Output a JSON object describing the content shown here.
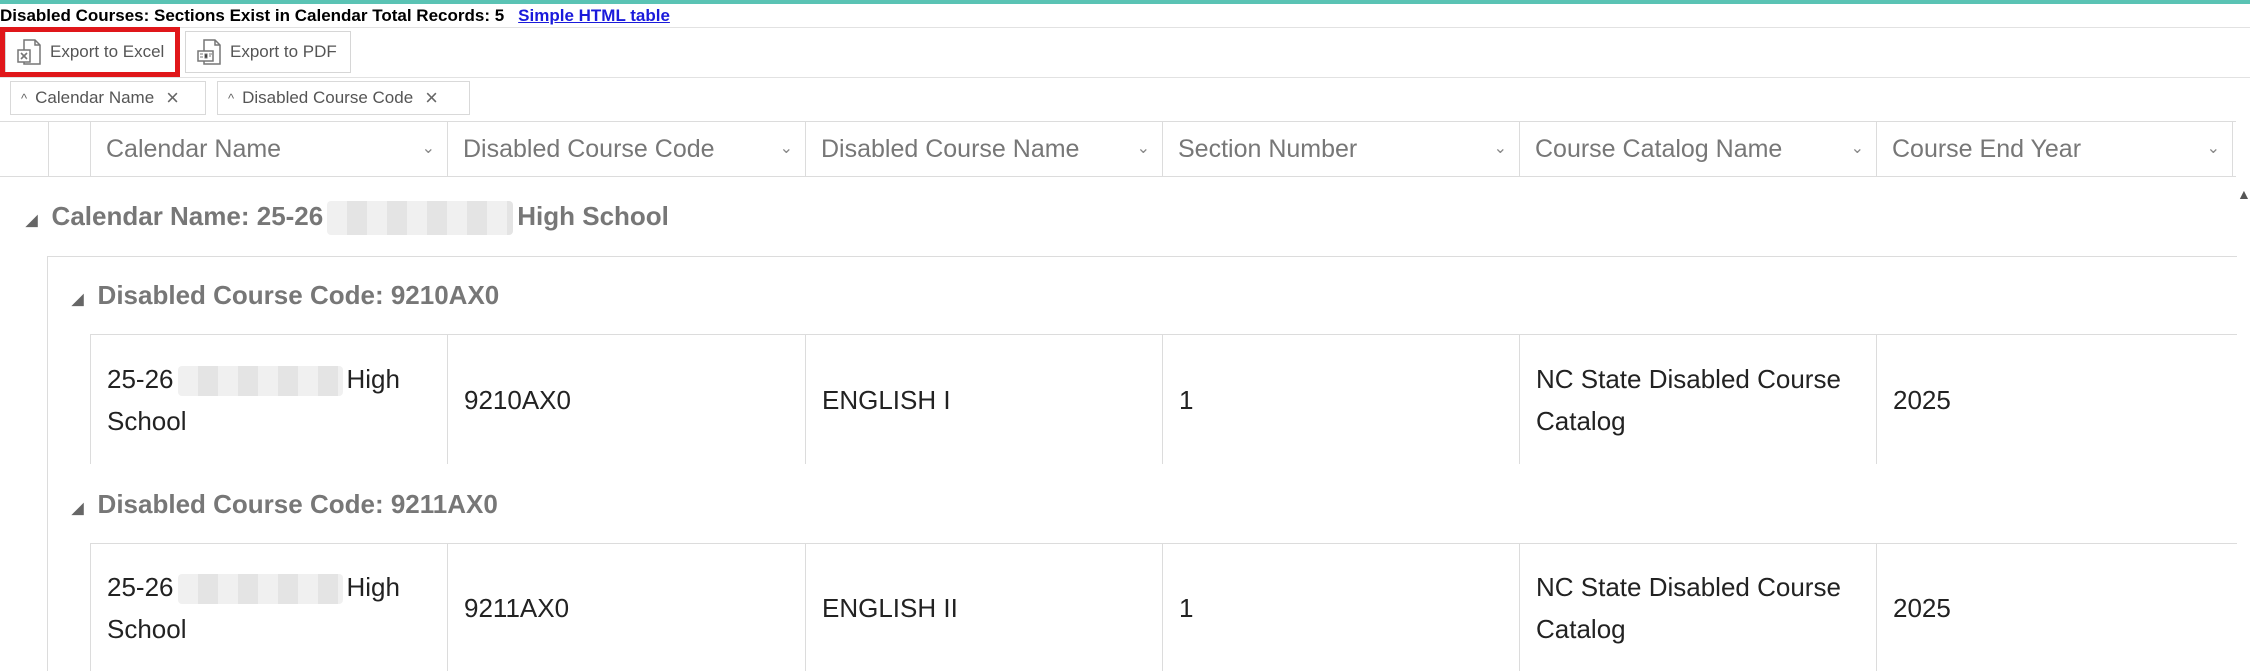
{
  "title": {
    "text": "Disabled Courses: Sections Exist in Calendar Total Records: 5",
    "link": "Simple HTML table"
  },
  "toolbar": {
    "export_excel": "Export to Excel",
    "export_pdf": "Export to PDF"
  },
  "group_chips": [
    {
      "label": "Calendar Name",
      "sort_icon": "^",
      "remove_icon": "×"
    },
    {
      "label": "Disabled Course Code",
      "sort_icon": "^",
      "remove_icon": "×"
    }
  ],
  "columns": [
    "Calendar Name",
    "Disabled Course Code",
    "Disabled Course Name",
    "Section Number",
    "Course Catalog Name",
    "Course End Year"
  ],
  "calendar_group": {
    "prefix": "Calendar Name: 25-26",
    "suffix": "High School",
    "expander": "◢"
  },
  "course_groups": [
    {
      "header": "Disabled Course Code: 9210AX0",
      "expander": "◢",
      "row": {
        "calendar_prefix": "25-26",
        "calendar_suffix": "High",
        "calendar_line2": "School",
        "code": "9210AX0",
        "name": "ENGLISH I",
        "section": "1",
        "catalog": "NC State Disabled Course Catalog",
        "end_year": "2025"
      }
    },
    {
      "header": "Disabled Course Code: 9211AX0",
      "expander": "◢",
      "row": {
        "calendar_prefix": "25-26",
        "calendar_suffix": "High",
        "calendar_line2": "School",
        "code": "9211AX0",
        "name": "ENGLISH II",
        "section": "1",
        "catalog": "NC State Disabled Course Catalog",
        "end_year": "2025"
      }
    }
  ],
  "icons": {
    "excel": "excel-file-icon",
    "pdf": "pdf-file-icon",
    "column_menu": "chevron-down-icon",
    "scroll_up": "▲"
  },
  "colors": {
    "highlight": "#e0171a",
    "link": "#1a1adb",
    "top_accent": "#5ac3b4"
  }
}
